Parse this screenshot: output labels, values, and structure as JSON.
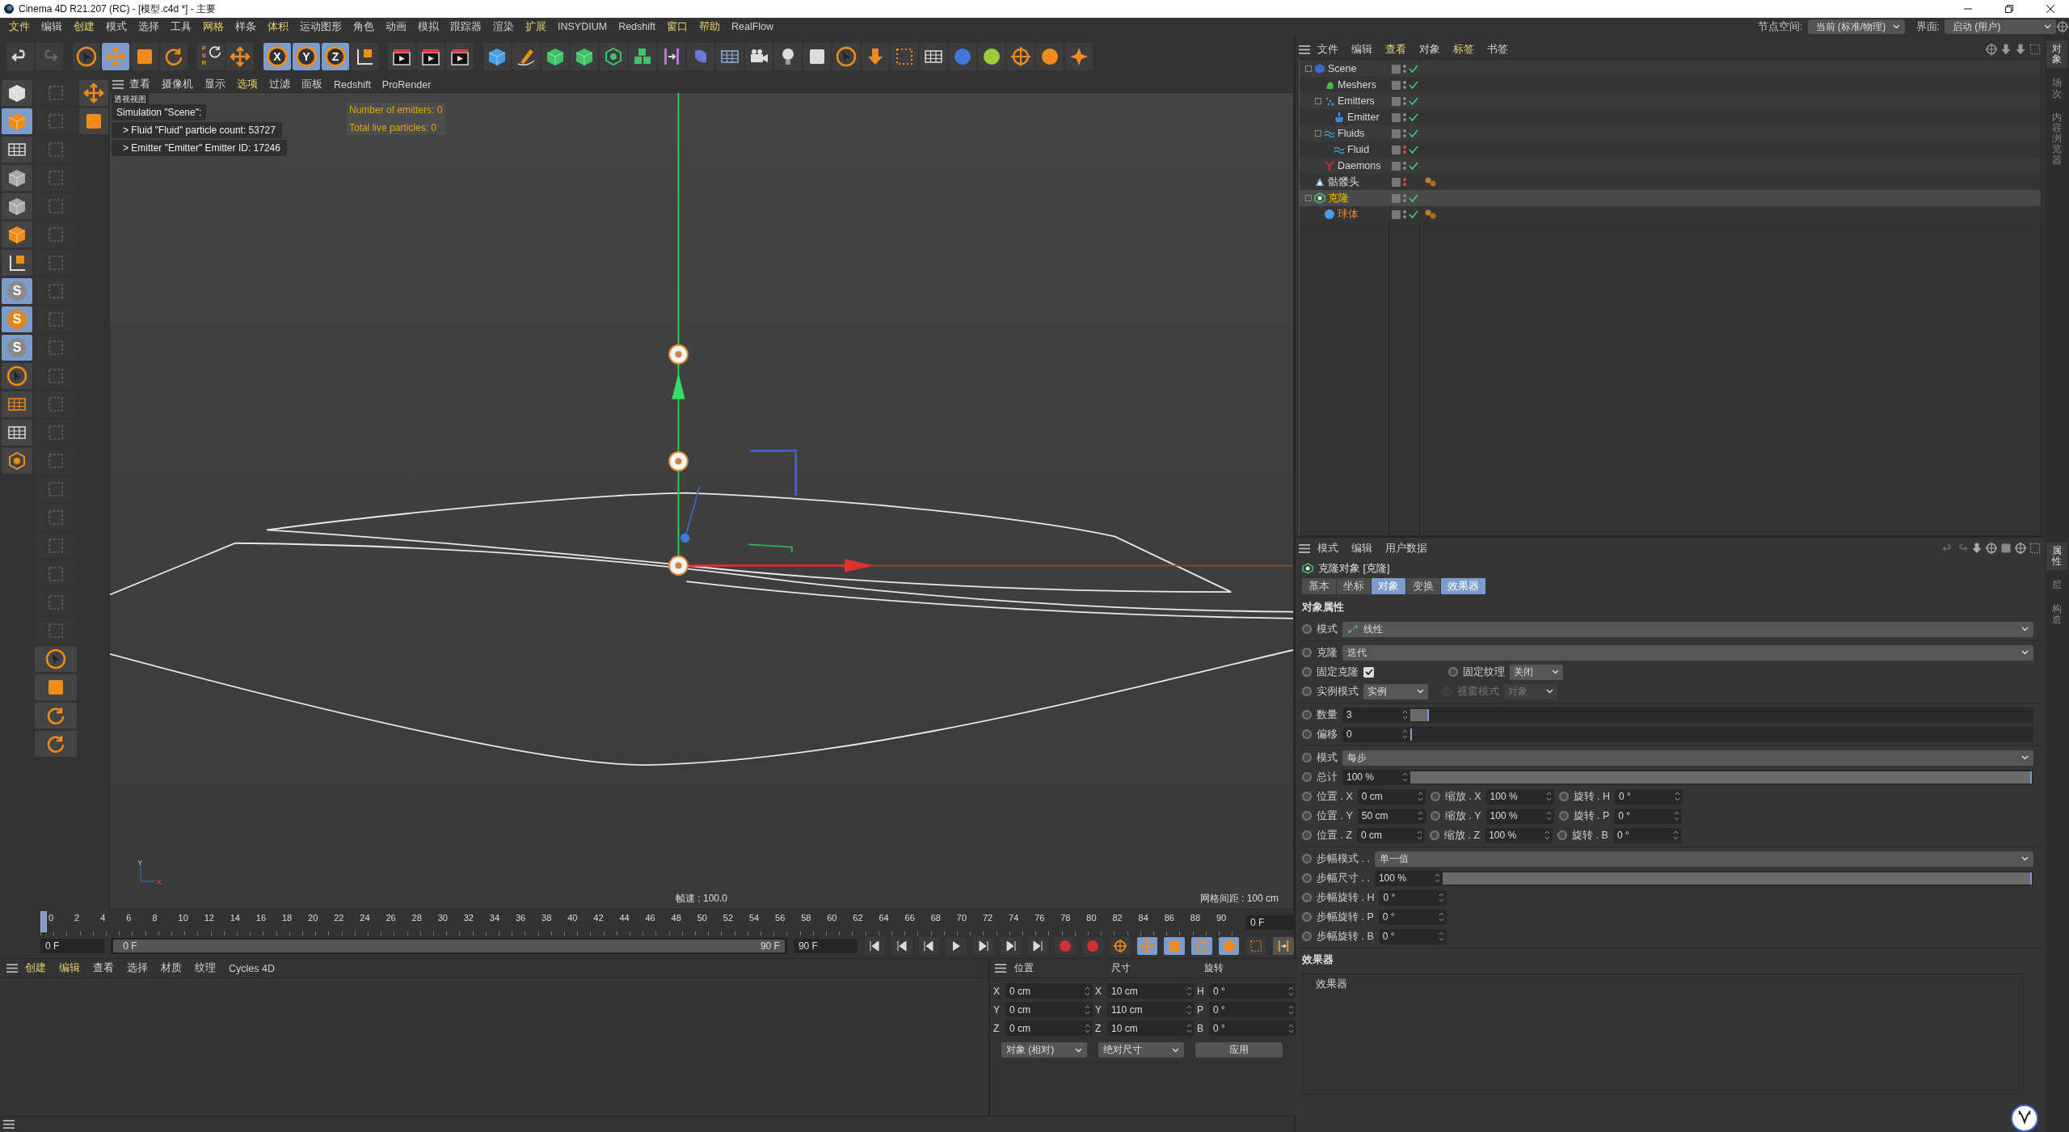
{
  "window": {
    "title": "Cinema 4D R21.207 (RC) - [模型.c4d *] - 主要"
  },
  "menu_bar": [
    {
      "label": "文件",
      "highlighted": true
    },
    {
      "label": "编辑",
      "highlighted": false
    },
    {
      "label": "创建",
      "highlighted": true
    },
    {
      "label": "模式",
      "highlighted": false
    },
    {
      "label": "选择",
      "highlighted": false
    },
    {
      "label": "工具",
      "highlighted": false
    },
    {
      "label": "网格",
      "highlighted": true
    },
    {
      "label": "样条",
      "highlighted": false
    },
    {
      "label": "体积",
      "highlighted": true
    },
    {
      "label": "运动图形",
      "highlighted": false
    },
    {
      "label": "角色",
      "highlighted": false
    },
    {
      "label": "动画",
      "highlighted": false
    },
    {
      "label": "模拟",
      "highlighted": false
    },
    {
      "label": "跟踪器",
      "highlighted": false
    },
    {
      "label": "渲染",
      "highlighted": false
    },
    {
      "label": "扩展",
      "highlighted": true
    },
    {
      "label": "INSYDIUM",
      "highlighted": false
    },
    {
      "label": "Redshift",
      "highlighted": false
    },
    {
      "label": "窗口",
      "highlighted": true
    },
    {
      "label": "帮助",
      "highlighted": true
    },
    {
      "label": "RealFlow",
      "highlighted": false
    }
  ],
  "node_space": {
    "label": "节点空间:",
    "value": "当前 (标准/物理)"
  },
  "layout_switch": {
    "label": "界面:",
    "value": "启动 (用户)"
  },
  "toolbar": {
    "psr_label": "PSR",
    "axis_buttons": [
      {
        "label": "X",
        "selected": true
      },
      {
        "label": "Y",
        "selected": true
      },
      {
        "label": "Z",
        "selected": true
      }
    ]
  },
  "left_toolbar": {
    "s_buttons": [
      "S",
      "S",
      "S"
    ]
  },
  "viewport": {
    "menu": [
      {
        "label": "查看",
        "highlighted": false
      },
      {
        "label": "摄像机",
        "highlighted": false
      },
      {
        "label": "显示",
        "highlighted": false
      },
      {
        "label": "选项",
        "highlighted": true
      },
      {
        "label": "过滤",
        "highlighted": false
      },
      {
        "label": "面板",
        "highlighted": false
      },
      {
        "label": "Redshift",
        "highlighted": false
      },
      {
        "label": "ProRender",
        "highlighted": false
      }
    ],
    "view_name": "透视视图",
    "hud_lines": [
      "Simulation \"Scene\":",
      "> Fluid \"Fluid\" particle count: 53727",
      "> Emitter \"Emitter\" Emitter ID: 17246"
    ],
    "stats": [
      "Number of emitters: 0",
      "Total live particles: 0"
    ],
    "frame_rate": "帧速 : 100.0",
    "grid_spacing": "网格间距 : 100 cm",
    "axis_labels": [
      "Y",
      "X"
    ]
  },
  "timeline": {
    "ticks": [
      "0",
      "2",
      "4",
      "6",
      "8",
      "10",
      "12",
      "14",
      "16",
      "18",
      "20",
      "22",
      "24",
      "26",
      "28",
      "30",
      "32",
      "34",
      "36",
      "38",
      "40",
      "42",
      "44",
      "46",
      "48",
      "50",
      "52",
      "54",
      "56",
      "58",
      "60",
      "62",
      "64",
      "66",
      "68",
      "70",
      "72",
      "74",
      "76",
      "78",
      "80",
      "82",
      "84",
      "86",
      "88",
      "90"
    ],
    "level": 0,
    "current_frame": "0 F",
    "start": "0 F",
    "range": {
      "level": 1,
      "start": "0 F",
      "end": "90 F"
    },
    "end": "90 F"
  },
  "material_manager": {
    "menu": [
      {
        "label": "创建",
        "highlighted": true
      },
      {
        "label": "编辑",
        "highlighted": true
      },
      {
        "label": "查看",
        "highlighted": false
      },
      {
        "label": "选择",
        "highlighted": false
      },
      {
        "label": "材质",
        "highlighted": false
      },
      {
        "label": "纹理",
        "highlighted": false
      },
      {
        "label": "Cycles 4D",
        "highlighted": false
      }
    ]
  },
  "coordinates": {
    "headers": [
      "位置",
      "尺寸",
      "旋转"
    ],
    "rows": [
      {
        "cells": [
          {
            "axis": "X",
            "value": "0 cm"
          },
          {
            "axis": "X",
            "value": "10 cm"
          },
          {
            "axis": "H",
            "value": "0 °"
          }
        ]
      },
      {
        "cells": [
          {
            "axis": "Y",
            "value": "0 cm"
          },
          {
            "axis": "Y",
            "value": "110 cm"
          },
          {
            "axis": "P",
            "value": "0 °"
          }
        ]
      },
      {
        "cells": [
          {
            "axis": "Z",
            "value": "0 cm"
          },
          {
            "axis": "Z",
            "value": "10 cm"
          },
          {
            "axis": "B",
            "value": "0 °"
          }
        ]
      }
    ],
    "mode": "对象 (相对)",
    "size_mode": "绝对尺寸",
    "apply": "应用"
  },
  "object_manager": {
    "menu": [
      {
        "label": "文件",
        "highlighted": false
      },
      {
        "label": "编辑",
        "highlighted": false
      },
      {
        "label": "查看",
        "highlighted": true
      },
      {
        "label": "对象",
        "highlighted": false
      },
      {
        "label": "标签",
        "highlighted": true
      },
      {
        "label": "书签",
        "highlighted": false
      }
    ],
    "objects": [
      {
        "label": "Scene",
        "color": "#d8d8d8",
        "hidden": false,
        "enabled": true,
        "tag": false,
        "selected": false,
        "children": [
          {
            "label": "Meshers",
            "color": "#d8d8d8",
            "hidden": false,
            "enabled": true,
            "tag": false,
            "selected": false
          },
          {
            "label": "Emitters",
            "color": "#d8d8d8",
            "hidden": false,
            "enabled": true,
            "tag": false,
            "selected": false,
            "children": [
              {
                "label": "Emitter",
                "color": "#d8d8d8",
                "hidden": false,
                "enabled": true,
                "tag": false,
                "selected": false
              }
            ]
          },
          {
            "label": "Fluids",
            "color": "#d8d8d8",
            "hidden": false,
            "enabled": true,
            "tag": false,
            "selected": false,
            "children": [
              {
                "label": "Fluid",
                "color": "#d8d8d8",
                "hidden": true,
                "enabled": true,
                "tag": false,
                "selected": false
              }
            ]
          },
          {
            "label": "Daemons",
            "color": "#d8d8d8",
            "hidden": false,
            "enabled": true,
            "tag": false,
            "selected": false
          }
        ]
      },
      {
        "label": "骷髅头",
        "color": "#d8d8d8",
        "hidden": true,
        "enabled": false,
        "tag": true,
        "selected": false
      },
      {
        "label": "克隆",
        "color": "#f2c200",
        "hidden": false,
        "enabled": true,
        "tag": false,
        "selected": true,
        "children": [
          {
            "label": "球体",
            "color": "#e08a3a",
            "hidden": false,
            "enabled": true,
            "tag": true,
            "selected": false
          }
        ]
      }
    ]
  },
  "side_tabs_top": [
    {
      "label": "对象",
      "selected": true
    },
    {
      "label": "场次",
      "selected": false
    },
    {
      "label": "内容浏览器",
      "selected": false
    }
  ],
  "side_tabs_bottom": [
    {
      "label": "属性",
      "selected": true
    },
    {
      "label": "层",
      "selected": false
    },
    {
      "label": "构造",
      "selected": false
    }
  ],
  "attributes": {
    "menu": [
      {
        "label": "模式",
        "highlighted": false
      },
      {
        "label": "编辑",
        "highlighted": false
      },
      {
        "label": "用户数据",
        "highlighted": false
      }
    ],
    "title": "克隆对象 [克隆]",
    "tabs": [
      {
        "label": "基本",
        "selected": false
      },
      {
        "label": "坐标",
        "selected": false
      },
      {
        "label": "对象",
        "selected": true
      },
      {
        "label": "变换",
        "selected": false
      },
      {
        "label": "效果器",
        "selected": true
      }
    ],
    "section": "对象属性",
    "groups": [
      {
        "rows": [
          {
            "kind": "dropdown",
            "label": "模式",
            "value": "线性",
            "icon": true
          }
        ]
      },
      {
        "rows": [
          {
            "kind": "dropdown",
            "label": "克隆",
            "value": "迭代"
          },
          {
            "kind": "check_dropdown",
            "label": "固定克隆",
            "checked": true,
            "label2": "固定纹理",
            "value2": "关闭"
          },
          {
            "kind": "dropdown_pair",
            "label": "实例模式",
            "value": "实例",
            "label2": "视窗模式",
            "value2": "对象",
            "disabled2": true
          }
        ]
      },
      {
        "rows": [
          {
            "kind": "slider",
            "label": "数量",
            "value": "3",
            "level": 0.03
          },
          {
            "kind": "slider",
            "label": "偏移",
            "value": "0",
            "level": 0
          }
        ]
      },
      {
        "rows": [
          {
            "kind": "dropdown",
            "label": "模式",
            "value": "每步"
          },
          {
            "kind": "slider",
            "label": "总计",
            "value": "100 %",
            "level": 1
          },
          {
            "kind": "triple",
            "cells": [
              {
                "label": "位置 . X",
                "value": "0 cm"
              },
              {
                "label": "缩放 . X",
                "value": "100 %"
              },
              {
                "label": "旋转 . H",
                "value": "0 °"
              }
            ]
          },
          {
            "kind": "triple",
            "cells": [
              {
                "label": "位置 . Y",
                "value": "50 cm"
              },
              {
                "label": "缩放 . Y",
                "value": "100 %"
              },
              {
                "label": "旋转 . P",
                "value": "0 °"
              }
            ]
          },
          {
            "kind": "triple",
            "cells": [
              {
                "label": "位置 . Z",
                "value": "0 cm"
              },
              {
                "label": "缩放 . Z",
                "value": "100 %"
              },
              {
                "label": "旋转 . B",
                "value": "0 °"
              }
            ]
          }
        ]
      },
      {
        "rows": [
          {
            "kind": "dropdown",
            "label": "步幅模式 . .",
            "value": "单一值"
          },
          {
            "kind": "slider",
            "label": "步幅尺寸 . .",
            "value": "100 %",
            "level": 1
          },
          {
            "kind": "spin",
            "label": "步幅旋转 . H",
            "value": "0 °"
          },
          {
            "kind": "spin",
            "label": "步幅旋转 . P",
            "value": "0 °"
          },
          {
            "kind": "spin",
            "label": "步幅旋转 . B",
            "value": "0 °"
          }
        ]
      }
    ],
    "effectors_section": "效果器",
    "effectors_list_header": "效果器"
  }
}
